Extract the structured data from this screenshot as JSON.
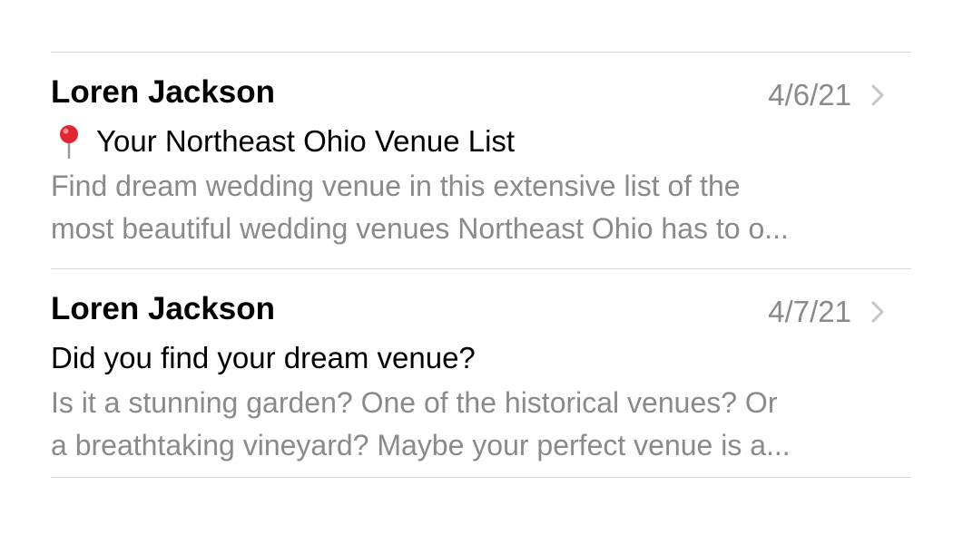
{
  "messages": [
    {
      "sender": "Loren Jackson",
      "date": "4/6/21",
      "subject_icon": "round-pushpin-icon",
      "subject": "Your Northeast Ohio Venue List",
      "preview_line1": "Find dream wedding venue in this extensive list of the",
      "preview_line2": "most beautiful wedding venues Northeast Ohio has to o..."
    },
    {
      "sender": "Loren Jackson",
      "date": "4/7/21",
      "subject": "Did you find your dream venue?",
      "preview_line1": "Is it a stunning garden? One of the historical venues? Or",
      "preview_line2": "a breathtaking vineyard? Maybe your perfect venue is a..."
    }
  ],
  "colors": {
    "primary_text": "#000000",
    "secondary_text": "#8a8a8e",
    "divider": "#d8d8d8",
    "pin_red": "#e0262f"
  }
}
